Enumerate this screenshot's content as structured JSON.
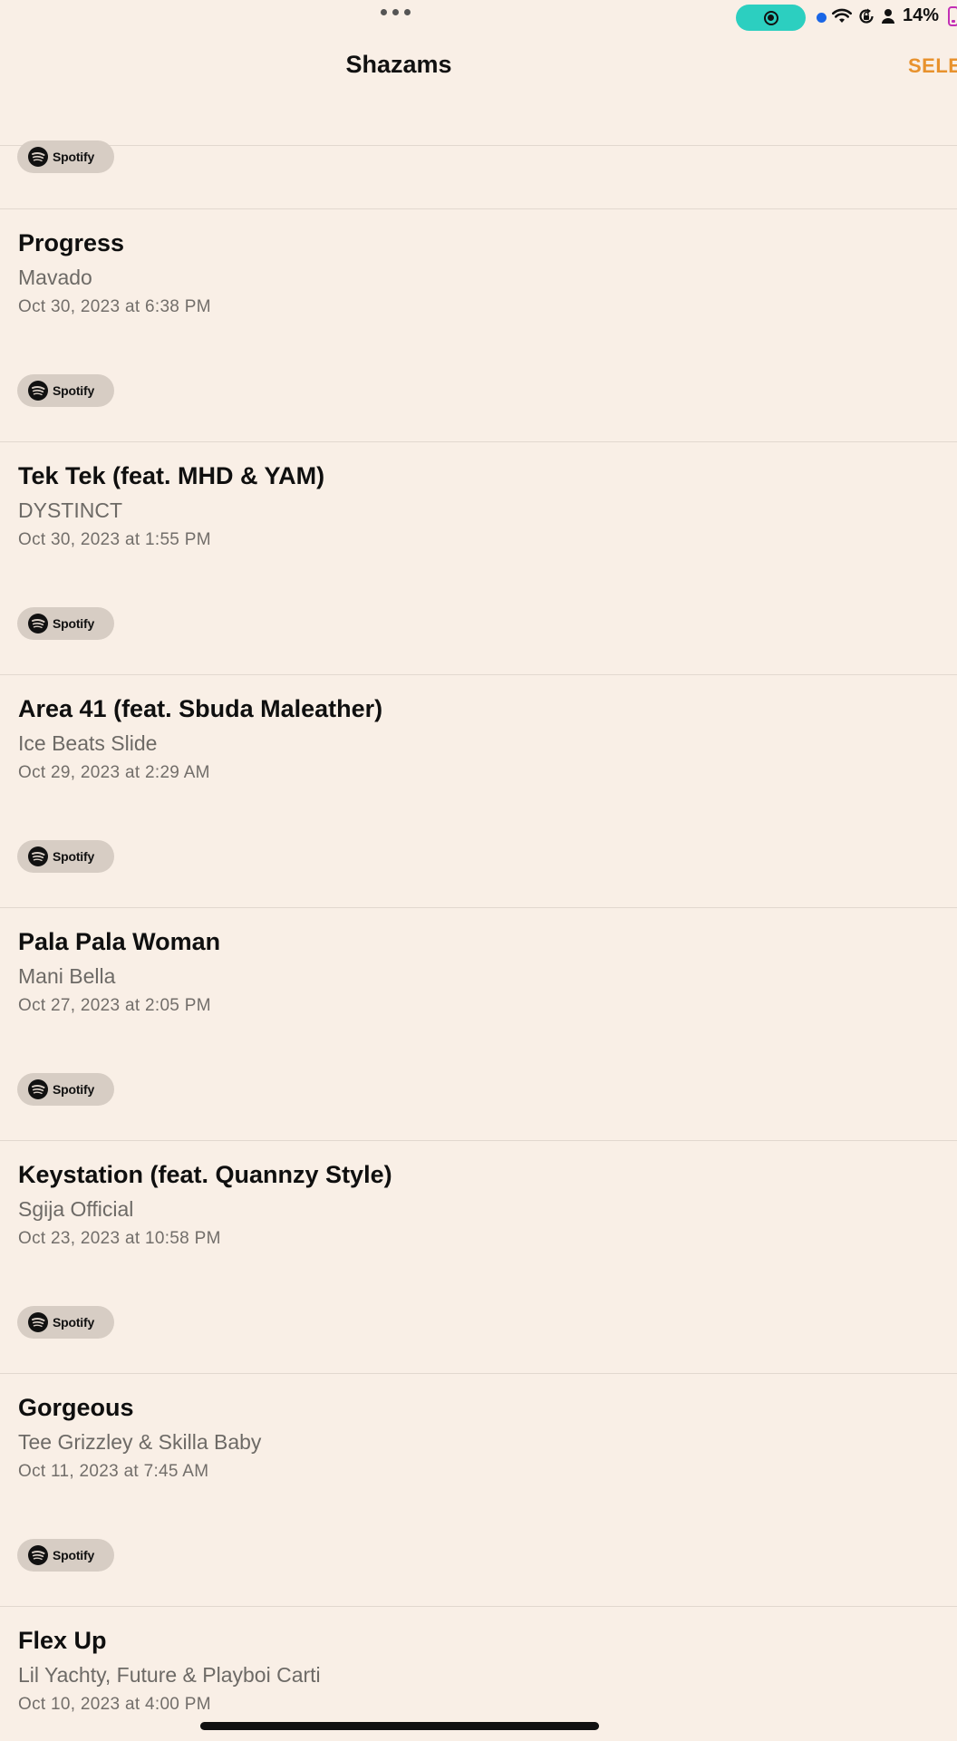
{
  "status_bar": {
    "battery_percent": "14%",
    "icons": [
      "more-dots-icon",
      "screen-record-icon",
      "blue-dot-indicator",
      "wifi-icon",
      "rotation-lock-icon",
      "person-icon",
      "battery-icon"
    ]
  },
  "header": {
    "title": "Shazams",
    "action_label": "SELECT"
  },
  "top_partial_item": {
    "button_label": "Spotify"
  },
  "items": [
    {
      "title": "Progress",
      "artist": "Mavado",
      "date": "Oct 30, 2023 at 6:38 PM",
      "button_label": "Spotify"
    },
    {
      "title": "Tek Tek (feat. MHD & YAM)",
      "artist": "DYSTINCT",
      "date": "Oct 30, 2023 at 1:55 PM",
      "button_label": "Spotify"
    },
    {
      "title": "Area 41 (feat. Sbuda Maleather)",
      "artist": "Ice Beats Slide",
      "date": "Oct 29, 2023 at 2:29 AM",
      "button_label": "Spotify"
    },
    {
      "title": "Pala Pala Woman",
      "artist": "Mani Bella",
      "date": "Oct 27, 2023 at 2:05 PM",
      "button_label": "Spotify"
    },
    {
      "title": "Keystation (feat. Quannzy Style)",
      "artist": "Sgija Official",
      "date": "Oct 23, 2023 at 10:58 PM",
      "button_label": "Spotify"
    },
    {
      "title": "Gorgeous",
      "artist": "Tee Grizzley & Skilla Baby",
      "date": "Oct 11, 2023 at 7:45 AM",
      "button_label": "Spotify"
    },
    {
      "title": "Flex Up",
      "artist": "Lil Yachty, Future & Playboi Carti",
      "date": "Oct 10, 2023 at 4:00 PM"
    }
  ],
  "colors": {
    "background": "#f9efe6",
    "accent": "#e8922d",
    "record_pill": "#2ccfc0",
    "battery": "#c22fb5"
  }
}
